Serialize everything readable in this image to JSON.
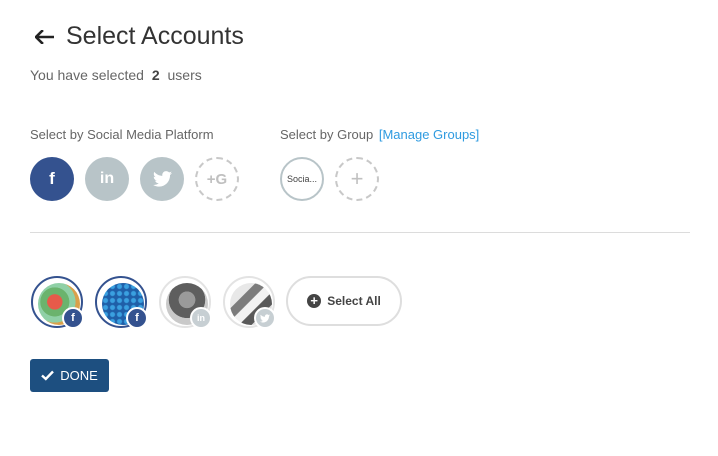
{
  "header": {
    "title": "Select Accounts"
  },
  "subtitle": {
    "prefix": "You have selected",
    "count": "2",
    "suffix": "users"
  },
  "platform_section": {
    "label": "Select by Social Media Platform",
    "platforms": [
      {
        "name": "facebook",
        "glyph": "f",
        "selected": true,
        "color": "#34528f"
      },
      {
        "name": "linkedin",
        "glyph": "in",
        "selected": false,
        "color": "#b8c4c8"
      },
      {
        "name": "twitter",
        "glyph": "twitter-bird",
        "selected": false,
        "color": "#b8c4c8"
      },
      {
        "name": "google-plus",
        "glyph": "+G",
        "selected": false
      }
    ]
  },
  "group_section": {
    "label": "Select by Group",
    "link": "[Manage Groups]",
    "groups": [
      {
        "label": "Socia..."
      }
    ],
    "add_glyph": "+"
  },
  "accounts": [
    {
      "network": "facebook",
      "selected": true,
      "badge_glyph": "f",
      "badge_color": "#34528f"
    },
    {
      "network": "facebook",
      "selected": true,
      "badge_glyph": "f",
      "badge_color": "#34528f"
    },
    {
      "network": "linkedin",
      "selected": false,
      "badge_glyph": "in",
      "badge_color": "#c7cfd3"
    },
    {
      "network": "twitter",
      "selected": false,
      "badge_glyph": "twitter-bird",
      "badge_color": "#c7cfd3"
    }
  ],
  "select_all": {
    "label": "Select All"
  },
  "done_button": {
    "label": "DONE"
  },
  "colors": {
    "brand_dark": "#1d4f80",
    "facebook": "#34528f",
    "link": "#2f9be0",
    "inactive": "#b8c4c8"
  }
}
